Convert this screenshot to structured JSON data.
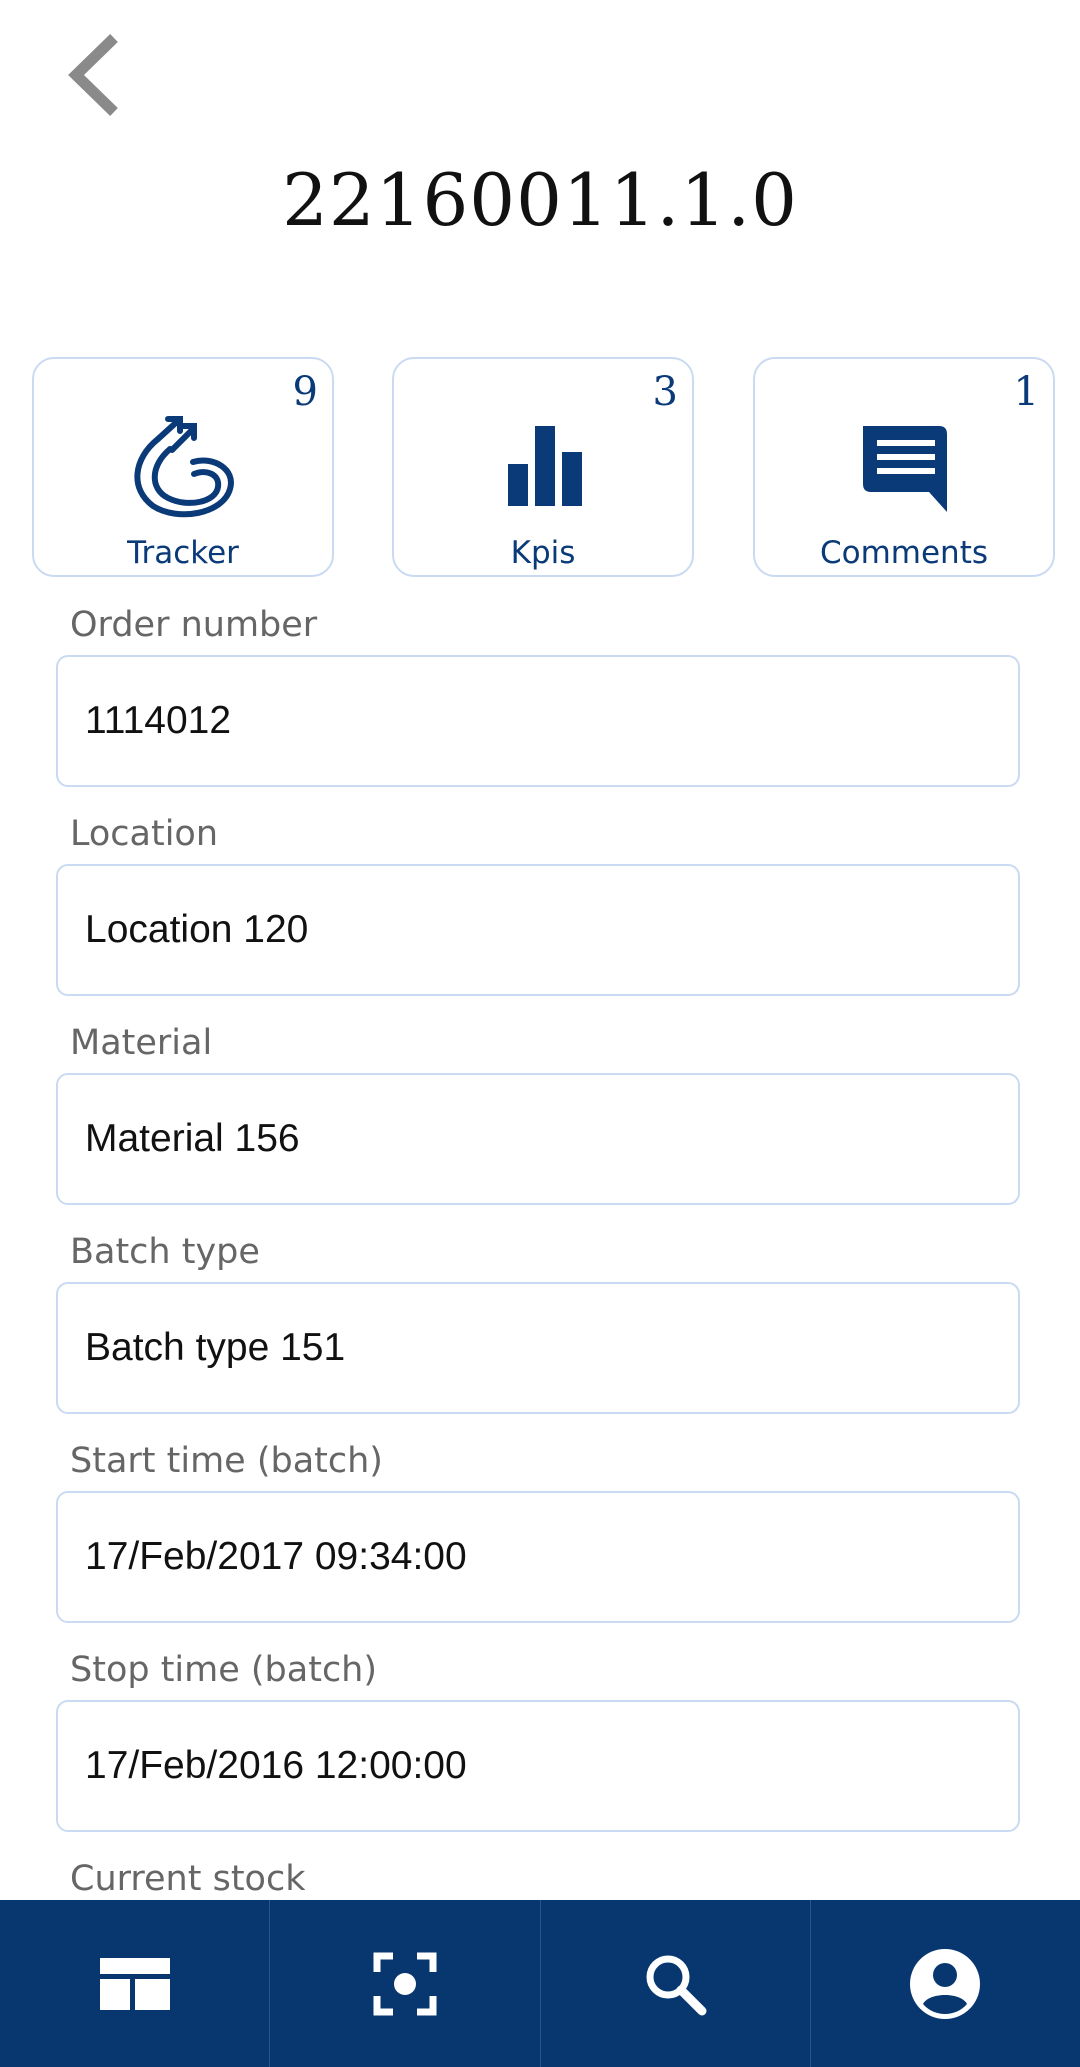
{
  "header": {
    "title": "22160011.1.0",
    "back_icon": "chevron-left-icon"
  },
  "tiles": [
    {
      "label": "Tracker",
      "count": "9",
      "icon": "tracker-icon"
    },
    {
      "label": "Kpis",
      "count": "3",
      "icon": "bar-chart-icon"
    },
    {
      "label": "Comments",
      "count": "1",
      "icon": "comment-icon"
    }
  ],
  "fields": [
    {
      "label": "Order number",
      "value": "1114012"
    },
    {
      "label": "Location",
      "value": "Location 120"
    },
    {
      "label": "Material",
      "value": "Material 156"
    },
    {
      "label": "Batch type",
      "value": "Batch type 151"
    },
    {
      "label": "Start time (batch)",
      "value": "17/Feb/2017 09:34:00"
    },
    {
      "label": "Stop time (batch)",
      "value": "17/Feb/2016 12:00:00"
    },
    {
      "label": "Current stock"
    }
  ],
  "bottom_nav": [
    {
      "icon": "dashboard-icon"
    },
    {
      "icon": "scan-icon"
    },
    {
      "icon": "search-icon"
    },
    {
      "icon": "account-icon"
    }
  ],
  "colors": {
    "accent": "#0b3a78",
    "nav_background": "#08376f",
    "border": "#c9daf2",
    "label_gray": "#666666"
  }
}
